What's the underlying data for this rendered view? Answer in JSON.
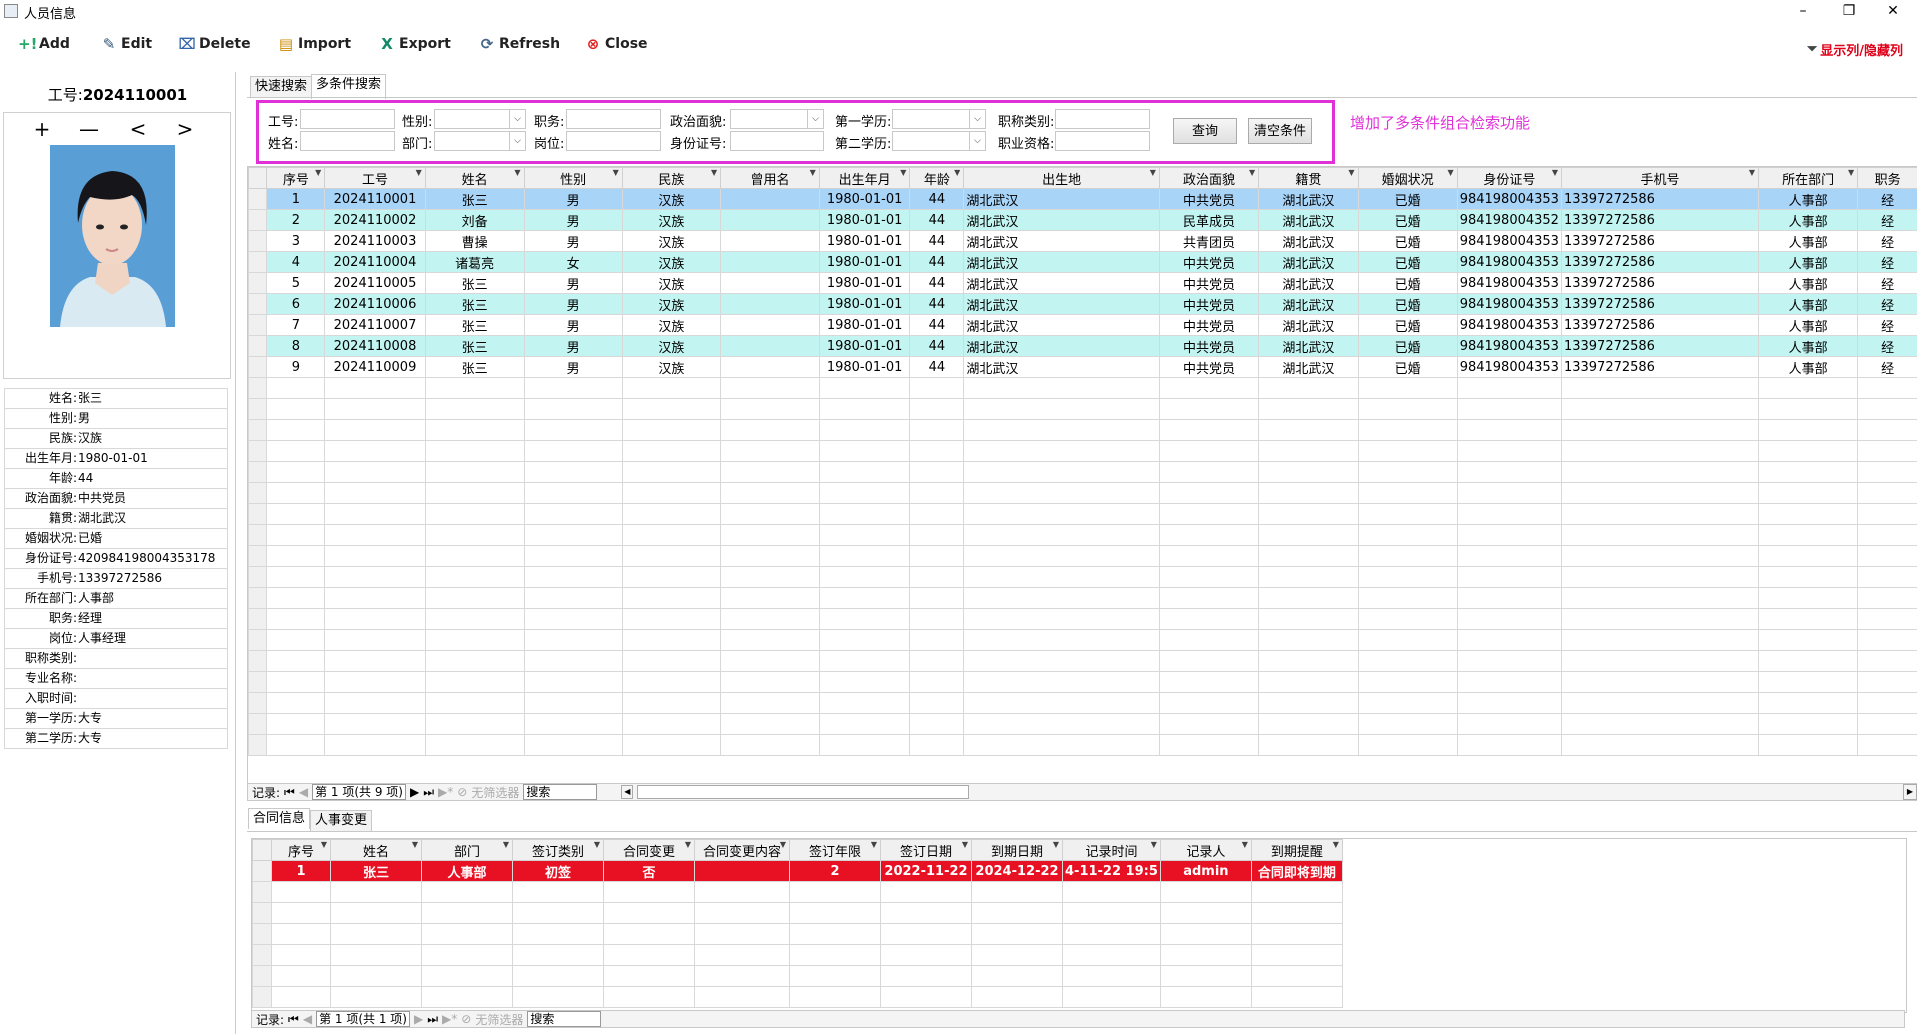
{
  "window": {
    "title": "人员信息",
    "minimize": "–",
    "restore": "❐",
    "close": "✕"
  },
  "toolbar": {
    "add": "Add",
    "edit": "Edit",
    "delete": "Delete",
    "import": "Import",
    "export": "Export",
    "refresh": "Refresh",
    "close": "Close",
    "show_hide_cols": "显示列/隐藏列"
  },
  "left": {
    "emp_label": "工号:",
    "emp_no": "2024110001",
    "nav": [
      "+",
      "—",
      "<",
      ">"
    ],
    "info": [
      {
        "label": "姓名:",
        "value": "张三"
      },
      {
        "label": "性别:",
        "value": "男"
      },
      {
        "label": "民族:",
        "value": "汉族"
      },
      {
        "label": "出生年月:",
        "value": "1980-01-01"
      },
      {
        "label": "年龄:",
        "value": "44"
      },
      {
        "label": "政治面貌:",
        "value": "中共党员"
      },
      {
        "label": "籍贯:",
        "value": "湖北武汉"
      },
      {
        "label": "婚姻状况:",
        "value": "已婚"
      },
      {
        "label": "身份证号:",
        "value": "420984198004353178"
      },
      {
        "label": "手机号:",
        "value": "13397272586"
      },
      {
        "label": "所在部门:",
        "value": "人事部"
      },
      {
        "label": "职务:",
        "value": "经理"
      },
      {
        "label": "岗位:",
        "value": "人事经理"
      },
      {
        "label": "职称类别:",
        "value": ""
      },
      {
        "label": "专业名称:",
        "value": ""
      },
      {
        "label": "入职时间:",
        "value": ""
      },
      {
        "label": "第一学历:",
        "value": "大专"
      },
      {
        "label": "第二学历:",
        "value": "大专"
      }
    ]
  },
  "search_tabs": [
    "快速搜索",
    "多条件搜索"
  ],
  "search": {
    "labels": {
      "empno": "工号:",
      "name": "姓名:",
      "gender": "性别:",
      "dept": "部门:",
      "duty": "职务:",
      "post": "岗位:",
      "political": "政治面貌:",
      "idcard": "身份证号:",
      "edu1": "第一学历:",
      "edu2": "第二学历:",
      "title_type": "职称类别:",
      "qualification": "职业资格:"
    },
    "query_btn": "查询",
    "clear_btn": "清空条件",
    "note": "增加了多条件组合检索功能"
  },
  "grid": {
    "columns": [
      "序号",
      "工号",
      "姓名",
      "性别",
      "民族",
      "曾用名",
      "出生年月",
      "年龄",
      "出生地",
      "政治面貌",
      "籍贯",
      "婚姻状况",
      "身份证号",
      "手机号",
      "所在部门",
      "职务"
    ],
    "rows": [
      [
        "1",
        "2024110001",
        "张三",
        "男",
        "汉族",
        "",
        "1980-01-01",
        "44",
        "湖北武汉",
        "中共党员",
        "湖北武汉",
        "已婚",
        "984198004353",
        "13397272586",
        "人事部",
        "经"
      ],
      [
        "2",
        "2024110002",
        "刘备",
        "男",
        "汉族",
        "",
        "1980-01-01",
        "44",
        "湖北武汉",
        "民革成员",
        "湖北武汉",
        "已婚",
        "984198004352",
        "13397272586",
        "人事部",
        "经"
      ],
      [
        "3",
        "2024110003",
        "曹操",
        "男",
        "汉族",
        "",
        "1980-01-01",
        "44",
        "湖北武汉",
        "共青团员",
        "湖北武汉",
        "已婚",
        "984198004353",
        "13397272586",
        "人事部",
        "经"
      ],
      [
        "4",
        "2024110004",
        "诸葛亮",
        "女",
        "汉族",
        "",
        "1980-01-01",
        "44",
        "湖北武汉",
        "中共党员",
        "湖北武汉",
        "已婚",
        "984198004353",
        "13397272586",
        "人事部",
        "经"
      ],
      [
        "5",
        "2024110005",
        "张三",
        "男",
        "汉族",
        "",
        "1980-01-01",
        "44",
        "湖北武汉",
        "中共党员",
        "湖北武汉",
        "已婚",
        "984198004353",
        "13397272586",
        "人事部",
        "经"
      ],
      [
        "6",
        "2024110006",
        "张三",
        "男",
        "汉族",
        "",
        "1980-01-01",
        "44",
        "湖北武汉",
        "中共党员",
        "湖北武汉",
        "已婚",
        "984198004353",
        "13397272586",
        "人事部",
        "经"
      ],
      [
        "7",
        "2024110007",
        "张三",
        "男",
        "汉族",
        "",
        "1980-01-01",
        "44",
        "湖北武汉",
        "中共党员",
        "湖北武汉",
        "已婚",
        "984198004353",
        "13397272586",
        "人事部",
        "经"
      ],
      [
        "8",
        "2024110008",
        "张三",
        "男",
        "汉族",
        "",
        "1980-01-01",
        "44",
        "湖北武汉",
        "中共党员",
        "湖北武汉",
        "已婚",
        "984198004353",
        "13397272586",
        "人事部",
        "经"
      ],
      [
        "9",
        "2024110009",
        "张三",
        "男",
        "汉族",
        "",
        "1980-01-01",
        "44",
        "湖北武汉",
        "中共党员",
        "湖北武汉",
        "已婚",
        "984198004353",
        "13397272586",
        "人事部",
        "经"
      ]
    ]
  },
  "grid_nav": {
    "record_label": "记录:",
    "page": "第 1 项(共 9 项)",
    "no_filter": "无筛选器",
    "search": "搜索"
  },
  "bottom_tabs": [
    "合同信息",
    "人事变更"
  ],
  "contract_grid": {
    "columns": [
      "序号",
      "姓名",
      "部门",
      "签订类别",
      "合同变更",
      "合同变更内容",
      "签订年限",
      "签订日期",
      "到期日期",
      "记录时间",
      "记录人",
      "到期提醒"
    ],
    "rows": [
      [
        "1",
        "张三",
        "人事部",
        "初签",
        "否",
        "",
        "2",
        "2022-11-22",
        "2024-12-22",
        "4-11-22 19:5",
        "admin",
        "合同即将到期"
      ]
    ]
  },
  "contract_nav": {
    "record_label": "记录:",
    "page": "第 1 项(共 1 项)",
    "no_filter": "无筛选器",
    "search": "搜索"
  },
  "colors": {
    "selected_row": "#a8d4f8",
    "alt_row": "#c2f5f2",
    "highlight_border": "#e030d8",
    "expiry_row": "#e81123"
  }
}
